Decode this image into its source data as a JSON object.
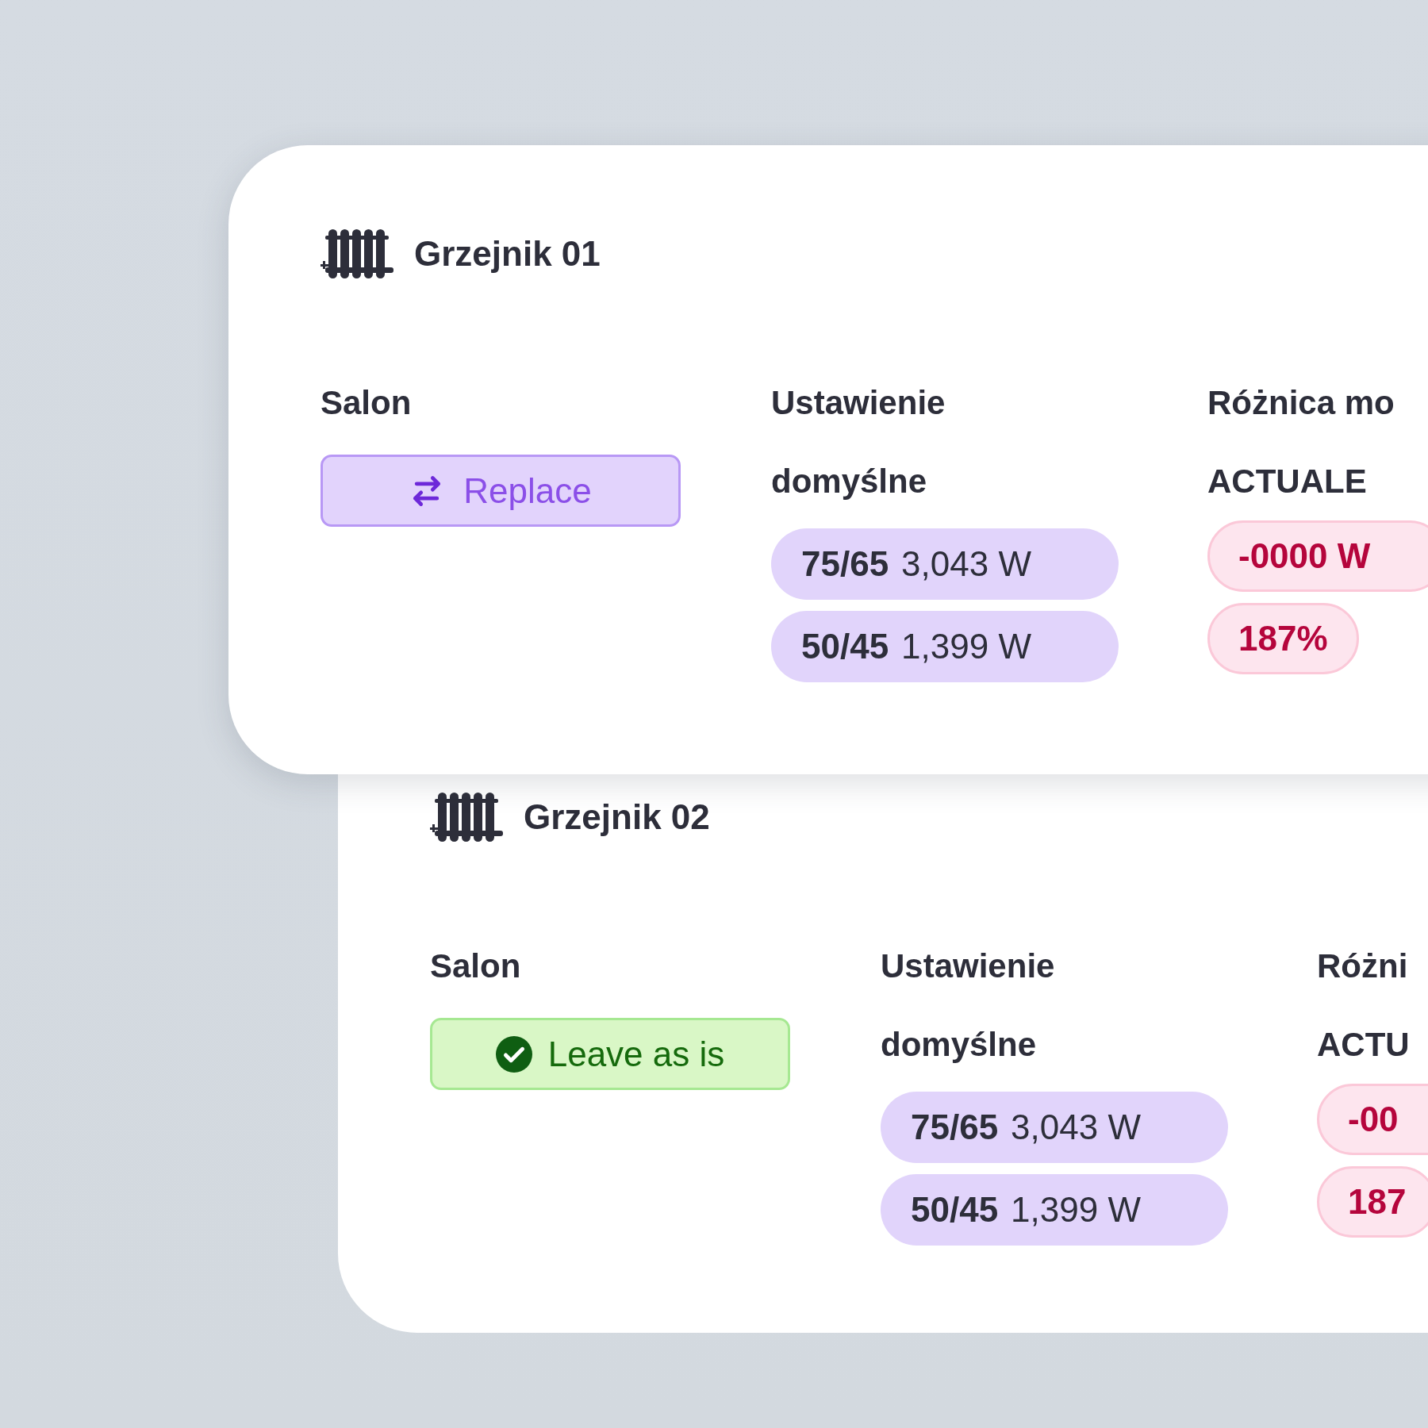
{
  "cards": [
    {
      "title": "Grzejnik 01",
      "room": "Salon",
      "action": {
        "kind": "replace",
        "label": "Replace"
      },
      "setting_label": [
        "Ustawienie",
        "domyślne"
      ],
      "settings": [
        {
          "temps": "75/65",
          "power": "3,043 W"
        },
        {
          "temps": "50/45",
          "power": "1,399 W"
        }
      ],
      "difference_label": [
        "Różnica mo",
        "ACTUALE"
      ],
      "differences": [
        "-0000 W",
        "187%"
      ]
    },
    {
      "title": "Grzejnik 02",
      "room": "Salon",
      "action": {
        "kind": "keep",
        "label": "Leave as is"
      },
      "setting_label": [
        "Ustawienie",
        "domyślne"
      ],
      "settings": [
        {
          "temps": "75/65",
          "power": "3,043 W"
        },
        {
          "temps": "50/45",
          "power": "1,399 W"
        }
      ],
      "difference_label": [
        "Różni",
        "ACTU"
      ],
      "differences": [
        "-00",
        "187"
      ]
    }
  ]
}
